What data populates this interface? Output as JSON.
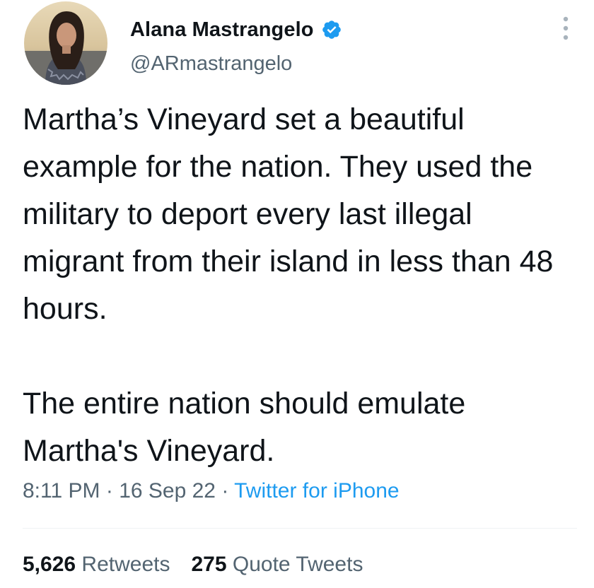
{
  "author": {
    "display_name": "Alana Mastrangelo",
    "handle": "@ARmastrangelo",
    "verified": true,
    "avatar": "profile-photo"
  },
  "tweet": {
    "paragraphs": [
      "Martha’s Vineyard set a beautiful example for the nation. They used the military to deport every last illegal migrant from their island in less than 48 hours.",
      "The entire nation should emulate Martha's Vineyard."
    ],
    "time": "8:11 PM",
    "separator": "·",
    "date": "16 Sep 22",
    "source": "Twitter for iPhone"
  },
  "stats": {
    "retweets_count": "5,626",
    "retweets_label": "Retweets",
    "quotes_count": "275",
    "quotes_label": "Quote Tweets"
  },
  "icons": {
    "verified": "verified-badge-icon",
    "more": "more-options-icon"
  },
  "colors": {
    "text": "#0f1419",
    "secondary": "#536471",
    "accent": "#1d9bf0",
    "divider": "#eff3f4"
  }
}
